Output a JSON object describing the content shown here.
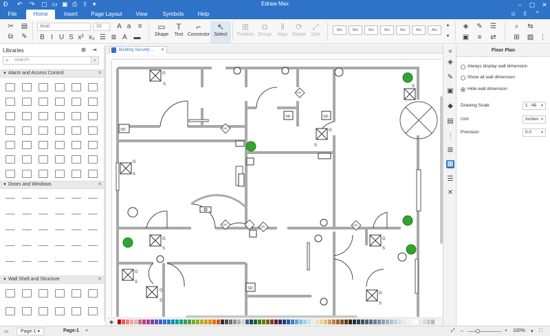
{
  "app": {
    "title": "Edraw Max"
  },
  "menu": {
    "tabs": [
      "File",
      "Home",
      "Insert",
      "Page Layout",
      "View",
      "Symbols",
      "Help"
    ],
    "active": "Home"
  },
  "ribbon": {
    "font_name": "Arial",
    "font_size": "10",
    "tools": {
      "shape": "Shape",
      "text": "Text",
      "connector": "Connector",
      "select": "Select"
    },
    "arrange": {
      "position": "Position",
      "group": "Group",
      "align": "Align",
      "rotate": "Rotate",
      "size": "Size"
    },
    "style_label": "Abc"
  },
  "library": {
    "title": "Libraries",
    "search_placeholder": "search",
    "categories": [
      {
        "name": "Alarm and Access Control"
      },
      {
        "name": "Doors and Windows"
      },
      {
        "name": "Wall Shell and Structure"
      }
    ]
  },
  "document": {
    "tab_title": "Building Security ..."
  },
  "floorplan_labels": {
    "sd": "SD",
    "gas": "GAS",
    "g": "G",
    "s": "S"
  },
  "properties": {
    "title": "Floor Plan",
    "wall_dimension_options": [
      {
        "label": "Always display wall dimension",
        "selected": false
      },
      {
        "label": "Show all wall dimension",
        "selected": false
      },
      {
        "label": "Hide wall dimension",
        "selected": true
      }
    ],
    "drawing_scale": {
      "label": "Drawing Scale",
      "value": "1 : 48"
    },
    "unit": {
      "label": "Unit",
      "value": "Inches"
    },
    "precision": {
      "label": "Precision",
      "value": "0.0"
    }
  },
  "status": {
    "page_selector": "Page-1",
    "active_page": "Page-1",
    "zoom": "100%"
  },
  "colors": {
    "accent": "#2e73c7",
    "wall": "#a8a8a8",
    "plant": "#2fa52f"
  }
}
